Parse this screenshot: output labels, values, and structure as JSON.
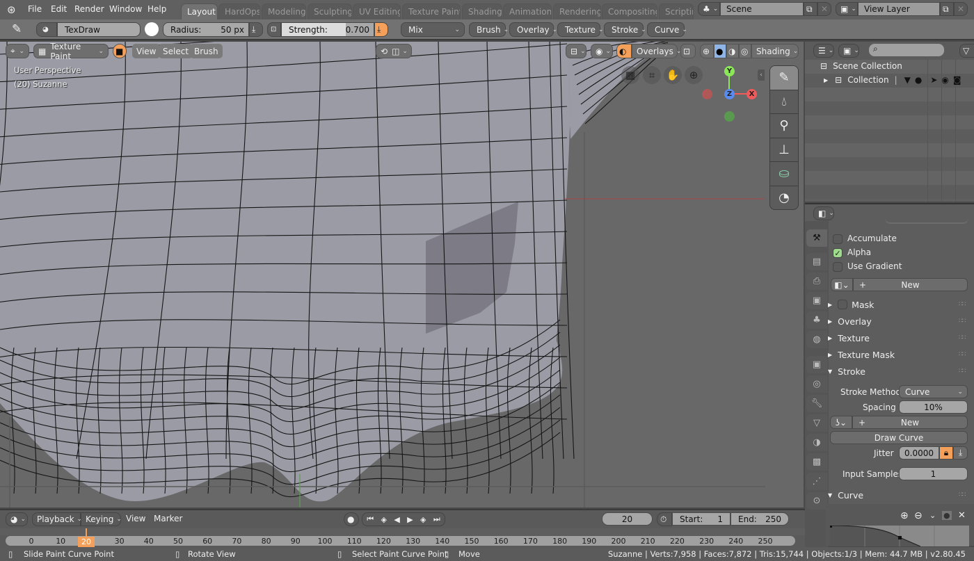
{
  "menu": {
    "logo_icon": "blender-logo-icon",
    "items": [
      "File",
      "Edit",
      "Render",
      "Window",
      "Help"
    ]
  },
  "workspaces": {
    "active": "Layout",
    "tabs": [
      "Layout",
      "HardOps",
      "Modeling",
      "Sculpting",
      "UV Editing",
      "Texture Paint",
      "Shading",
      "Animation",
      "Rendering",
      "Compositing",
      "Scripting"
    ]
  },
  "scene": {
    "label": "Scene",
    "view_layer": "View Layer"
  },
  "toolbar": {
    "brush_name": "TexDraw",
    "color": "#ffffff",
    "radius_label": "Radius:",
    "radius_value": "50 px",
    "strength_label": "Strength:",
    "strength_value": "0.700",
    "strength_fraction": 0.7,
    "blend_mode": "Mix",
    "dropdowns": [
      "Brush",
      "Overlay",
      "Texture",
      "Stroke",
      "Curve"
    ]
  },
  "viewport": {
    "mode": "Texture Paint",
    "menus": [
      "View",
      "Select",
      "Brush"
    ],
    "perspective": "User Perspective",
    "object_info": "(20) Suzanne",
    "overlays_label": "Overlays",
    "shading_label": "Shading",
    "gizmo": {
      "y": "Y",
      "z": "Z",
      "x": "X"
    },
    "tools": [
      "draw-brush",
      "soften-brush",
      "smear-brush",
      "clone-brush",
      "fill-brush",
      "mask-brush"
    ]
  },
  "outliner": {
    "search_placeholder": "",
    "scene_collection": "Scene Collection",
    "collection": "Collection"
  },
  "properties": {
    "accumulate": {
      "label": "Accumulate",
      "checked": false
    },
    "alpha": {
      "label": "Alpha",
      "checked": true
    },
    "use_gradient": {
      "label": "Use Gradient",
      "checked": false
    },
    "new_label": "New",
    "panels": {
      "mask": "Mask",
      "overlay": "Overlay",
      "texture": "Texture",
      "texture_mask": "Texture Mask",
      "stroke": "Stroke",
      "curve": "Curve"
    },
    "stroke_method_label": "Stroke Method",
    "stroke_method_value": "Curve",
    "spacing_label": "Spacing",
    "spacing_value": "10%",
    "curve_new_label": "New",
    "draw_curve_label": "Draw Curve",
    "jitter_label": "Jitter",
    "jitter_value": "0.0000",
    "input_samples_label": "Input Samples",
    "input_samples_value": "1",
    "tabs": [
      "tool",
      "render",
      "output",
      "view-layer",
      "scene",
      "world",
      "object",
      "physics",
      "modifiers",
      "object-data",
      "material",
      "texture",
      "particles",
      "constraints"
    ]
  },
  "timeline": {
    "menus": [
      "Playback",
      "Keying",
      "View",
      "Marker"
    ],
    "current_frame": "20",
    "start_label": "Start:",
    "start_value": "1",
    "end_label": "End:",
    "end_value": "250",
    "ticks": [
      "0",
      "10",
      "20",
      "30",
      "40",
      "50",
      "60",
      "70",
      "80",
      "90",
      "100",
      "110",
      "120",
      "130",
      "140",
      "150",
      "160",
      "170",
      "180",
      "190",
      "200",
      "210",
      "220",
      "230",
      "240",
      "250"
    ]
  },
  "statusbar": {
    "left_hint": "Slide Paint Curve Point",
    "middle_hint": "Rotate View",
    "right_hint": "Select Paint Curve Point",
    "move_hint": "Move",
    "stats": "Suzanne | Verts:7,958 | Faces:7,872 | Tris:15,744 | Objects:1/3 | Mem: 44.7 MB | v2.80.45"
  },
  "colors": {
    "accent": "#f5a05a",
    "x_axis": "#f05a5a",
    "y_axis": "#8ce65a",
    "z_axis": "#5a8cf0",
    "check_on": "#9edc8b"
  }
}
